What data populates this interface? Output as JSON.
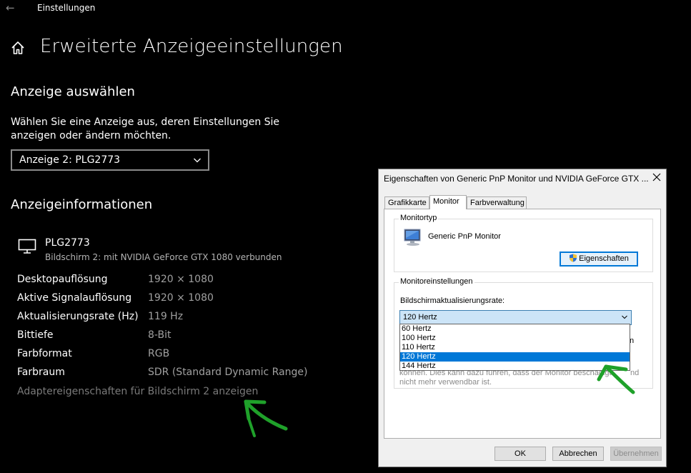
{
  "window": {
    "back_glyph": "←",
    "title": "Einstellungen"
  },
  "page": {
    "title": "Erweiterte Anzeigeeinstellungen",
    "icons": {
      "home": "home-icon",
      "monitor": "monitor-icon"
    }
  },
  "select_display": {
    "heading": "Anzeige auswählen",
    "description": "Wählen Sie eine Anzeige aus, deren Einstellungen Sie anzeigen oder ändern möchten.",
    "dropdown_value": "Anzeige 2: PLG2773"
  },
  "display_info": {
    "heading": "Anzeigeinformationen",
    "monitor_name": "PLG2773",
    "monitor_sub": "Bildschirm 2: mit NVIDIA GeForce GTX 1080 verbunden",
    "rows": [
      {
        "label": "Desktopauflösung",
        "value": "1920 × 1080"
      },
      {
        "label": "Aktive Signalauflösung",
        "value": "1920 × 1080"
      },
      {
        "label": "Aktualisierungsrate (Hz)",
        "value": "119 Hz"
      },
      {
        "label": "Bittiefe",
        "value": "8-Bit"
      },
      {
        "label": "Farbformat",
        "value": "RGB"
      },
      {
        "label": "Farbraum",
        "value": "SDR (Standard Dynamic Range)"
      }
    ],
    "adapter_link": "Adaptereigenschaften für Bildschirm 2 anzeigen"
  },
  "annotation_color": "#1fa12a",
  "dialog": {
    "title": "Eigenschaften von Generic PnP Monitor und NVIDIA GeForce GTX ...",
    "tabs": [
      "Grafikkarte",
      "Monitor",
      "Farbverwaltung"
    ],
    "active_tab": "Monitor",
    "monitor_type_group": "Monitortyp",
    "monitor_type_name": "Generic PnP Monitor",
    "properties_button": "Eigenschaften",
    "monitor_settings_group": "Monitoreinstellungen",
    "refresh_label": "Bildschirmaktualisierungsrate:",
    "refresh_value": "120 Hertz",
    "refresh_options": [
      "60 Hertz",
      "100 Hertz",
      "110 Hertz",
      "120 Hertz",
      "144 Hertz"
    ],
    "refresh_selected": "120 Hertz",
    "partial_text_1": "n",
    "partial_text_2": "können. Dies kann dazu führen, dass der Monitor beschädigt",
    "partial_text_2_end": "nd",
    "partial_text_3": "nicht mehr verwendbar ist.",
    "ok_button": "OK",
    "cancel_button": "Abbrechen",
    "apply_button": "Übernehmen"
  }
}
